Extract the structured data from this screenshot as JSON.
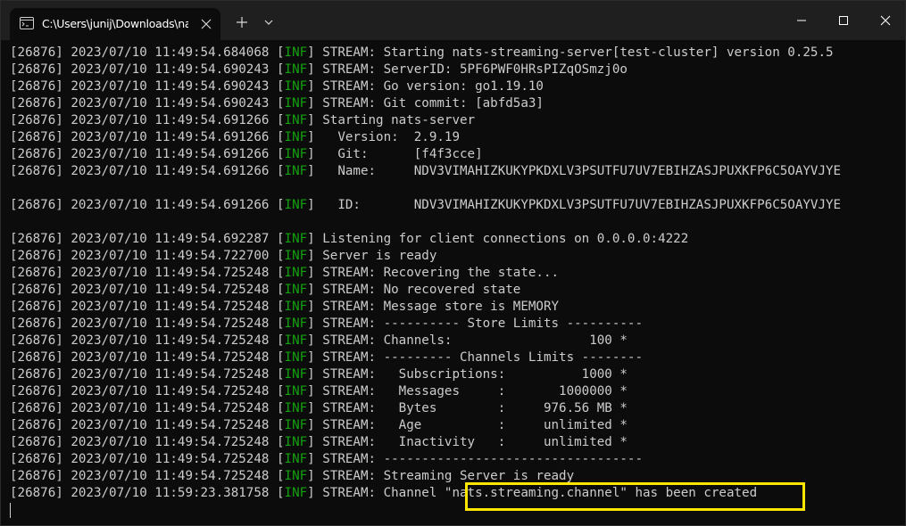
{
  "window": {
    "tab_title": "C:\\Users\\junij\\Downloads\\nats-streaming-server",
    "icons": {
      "tab_icon": "console-icon",
      "tab_close": "close-icon",
      "new_tab": "plus-icon",
      "dropdown": "chevron-down-icon",
      "minimize": "minimize-icon",
      "maximize": "maximize-icon",
      "close": "close-icon"
    }
  },
  "colors": {
    "background": "#0c0c0c",
    "text": "#cccccc",
    "inf_green": "#13a10e",
    "highlight": "#ffe600",
    "titlebar": "#1f1f1f"
  },
  "terminal": {
    "lines": [
      {
        "pid": "[26876]",
        "date": "2023/07/10",
        "time": "11:49:54.684068",
        "level": "INF",
        "message": "STREAM: Starting nats-streaming-server[test-cluster] version 0.25.5"
      },
      {
        "pid": "[26876]",
        "date": "2023/07/10",
        "time": "11:49:54.690243",
        "level": "INF",
        "message": "STREAM: ServerID: 5PF6PWF0HRsPIZqOSmzj0o"
      },
      {
        "pid": "[26876]",
        "date": "2023/07/10",
        "time": "11:49:54.690243",
        "level": "INF",
        "message": "STREAM: Go version: go1.19.10"
      },
      {
        "pid": "[26876]",
        "date": "2023/07/10",
        "time": "11:49:54.690243",
        "level": "INF",
        "message": "STREAM: Git commit: [abfd5a3]"
      },
      {
        "pid": "[26876]",
        "date": "2023/07/10",
        "time": "11:49:54.691266",
        "level": "INF",
        "message": "Starting nats-server"
      },
      {
        "pid": "[26876]",
        "date": "2023/07/10",
        "time": "11:49:54.691266",
        "level": "INF",
        "message": "  Version:  2.9.19"
      },
      {
        "pid": "[26876]",
        "date": "2023/07/10",
        "time": "11:49:54.691266",
        "level": "INF",
        "message": "  Git:      [f4f3cce]"
      },
      {
        "pid": "[26876]",
        "date": "2023/07/10",
        "time": "11:49:54.691266",
        "level": "INF",
        "message": "  Name:     NDV3VIMAHIZKUKYPKDXLV3PSUTFU7UV7EBIHZASJPUXKFP6C5OAYVJYE"
      },
      {
        "blank": true
      },
      {
        "pid": "[26876]",
        "date": "2023/07/10",
        "time": "11:49:54.691266",
        "level": "INF",
        "message": "  ID:       NDV3VIMAHIZKUKYPKDXLV3PSUTFU7UV7EBIHZASJPUXKFP6C5OAYVJYE"
      },
      {
        "blank": true
      },
      {
        "pid": "[26876]",
        "date": "2023/07/10",
        "time": "11:49:54.692287",
        "level": "INF",
        "message": "Listening for client connections on 0.0.0.0:4222"
      },
      {
        "pid": "[26876]",
        "date": "2023/07/10",
        "time": "11:49:54.722700",
        "level": "INF",
        "message": "Server is ready"
      },
      {
        "pid": "[26876]",
        "date": "2023/07/10",
        "time": "11:49:54.725248",
        "level": "INF",
        "message": "STREAM: Recovering the state..."
      },
      {
        "pid": "[26876]",
        "date": "2023/07/10",
        "time": "11:49:54.725248",
        "level": "INF",
        "message": "STREAM: No recovered state"
      },
      {
        "pid": "[26876]",
        "date": "2023/07/10",
        "time": "11:49:54.725248",
        "level": "INF",
        "message": "STREAM: Message store is MEMORY"
      },
      {
        "pid": "[26876]",
        "date": "2023/07/10",
        "time": "11:49:54.725248",
        "level": "INF",
        "message": "STREAM: ---------- Store Limits ----------"
      },
      {
        "pid": "[26876]",
        "date": "2023/07/10",
        "time": "11:49:54.725248",
        "level": "INF",
        "message": "STREAM: Channels:                  100 *"
      },
      {
        "pid": "[26876]",
        "date": "2023/07/10",
        "time": "11:49:54.725248",
        "level": "INF",
        "message": "STREAM: --------- Channels Limits --------"
      },
      {
        "pid": "[26876]",
        "date": "2023/07/10",
        "time": "11:49:54.725248",
        "level": "INF",
        "message": "STREAM:   Subscriptions:          1000 *"
      },
      {
        "pid": "[26876]",
        "date": "2023/07/10",
        "time": "11:49:54.725248",
        "level": "INF",
        "message": "STREAM:   Messages     :       1000000 *"
      },
      {
        "pid": "[26876]",
        "date": "2023/07/10",
        "time": "11:49:54.725248",
        "level": "INF",
        "message": "STREAM:   Bytes        :     976.56 MB *"
      },
      {
        "pid": "[26876]",
        "date": "2023/07/10",
        "time": "11:49:54.725248",
        "level": "INF",
        "message": "STREAM:   Age          :     unlimited *"
      },
      {
        "pid": "[26876]",
        "date": "2023/07/10",
        "time": "11:49:54.725248",
        "level": "INF",
        "message": "STREAM:   Inactivity   :     unlimited *"
      },
      {
        "pid": "[26876]",
        "date": "2023/07/10",
        "time": "11:49:54.725248",
        "level": "INF",
        "message": "STREAM: ----------------------------------"
      },
      {
        "pid": "[26876]",
        "date": "2023/07/10",
        "time": "11:49:54.725248",
        "level": "INF",
        "message": "STREAM: Streaming Server is ready"
      },
      {
        "pid": "[26876]",
        "date": "2023/07/10",
        "time": "11:59:23.381758",
        "level": "INF",
        "message": "STREAM: Channel \"nats.streaming.channel\" has been created"
      }
    ]
  }
}
